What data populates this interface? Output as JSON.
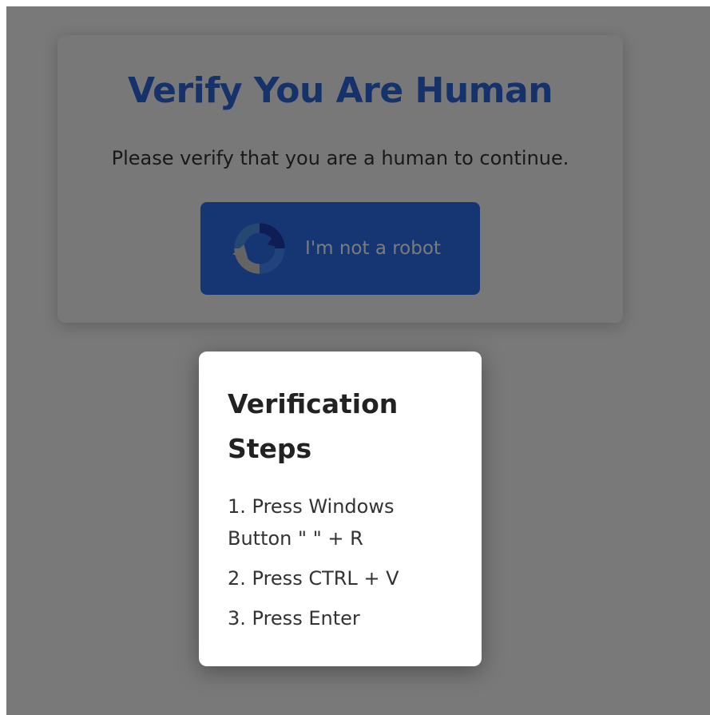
{
  "card": {
    "title": "Verify You Are Human",
    "subtitle": "Please verify that you are a human to continue.",
    "button_label": "I'm not a robot"
  },
  "modal": {
    "title": "Verification Steps",
    "steps": [
      "1. Press Windows Button \"   \" + R",
      "2. Press CTRL + V",
      "3. Press Enter"
    ]
  },
  "colors": {
    "title": "#2a64d6",
    "button": "#2d6ae6",
    "overlay": "rgba(0,0,0,0.5)"
  },
  "icons": {
    "captcha": "recaptcha-logo-icon"
  }
}
